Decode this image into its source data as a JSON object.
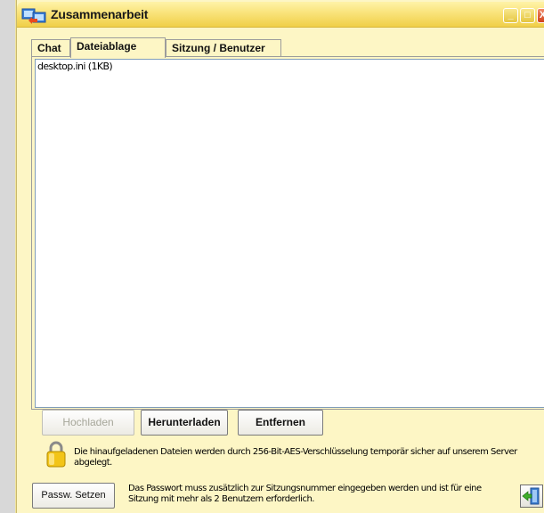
{
  "window": {
    "title": "Zusammenarbeit",
    "minimize_label": "_",
    "maximize_label": "□",
    "close_label": "X"
  },
  "tabs": [
    {
      "label": "Chat",
      "active": false
    },
    {
      "label": "Dateiablage",
      "active": true
    },
    {
      "label": "Sitzung / Benutzer",
      "active": false
    }
  ],
  "files": [
    {
      "label": "desktop.ini (1KB)"
    }
  ],
  "buttons": {
    "upload": "Hochladen",
    "download": "Herunterladen",
    "remove": "Entfernen",
    "set_password": "Passw. Setzen"
  },
  "info": {
    "encryption": "Die hinaufgeladenen Dateien werden durch 256-Bit-AES-Verschlüsselung temporär sicher auf unserem Server abgelegt.",
    "password": "Das Passwort muss zusätzlich zur Sitzungsnummer eingegeben werden und ist für eine Sitzung mit mehr als 2 Benutzern erforderlich."
  },
  "icons": {
    "app": "collaboration-icon",
    "lock": "lock-icon",
    "exit": "exit-door-icon"
  },
  "colors": {
    "window_background": "#fdf6c5",
    "titlebar": "#f0cf48",
    "list_background": "#ffffff"
  }
}
